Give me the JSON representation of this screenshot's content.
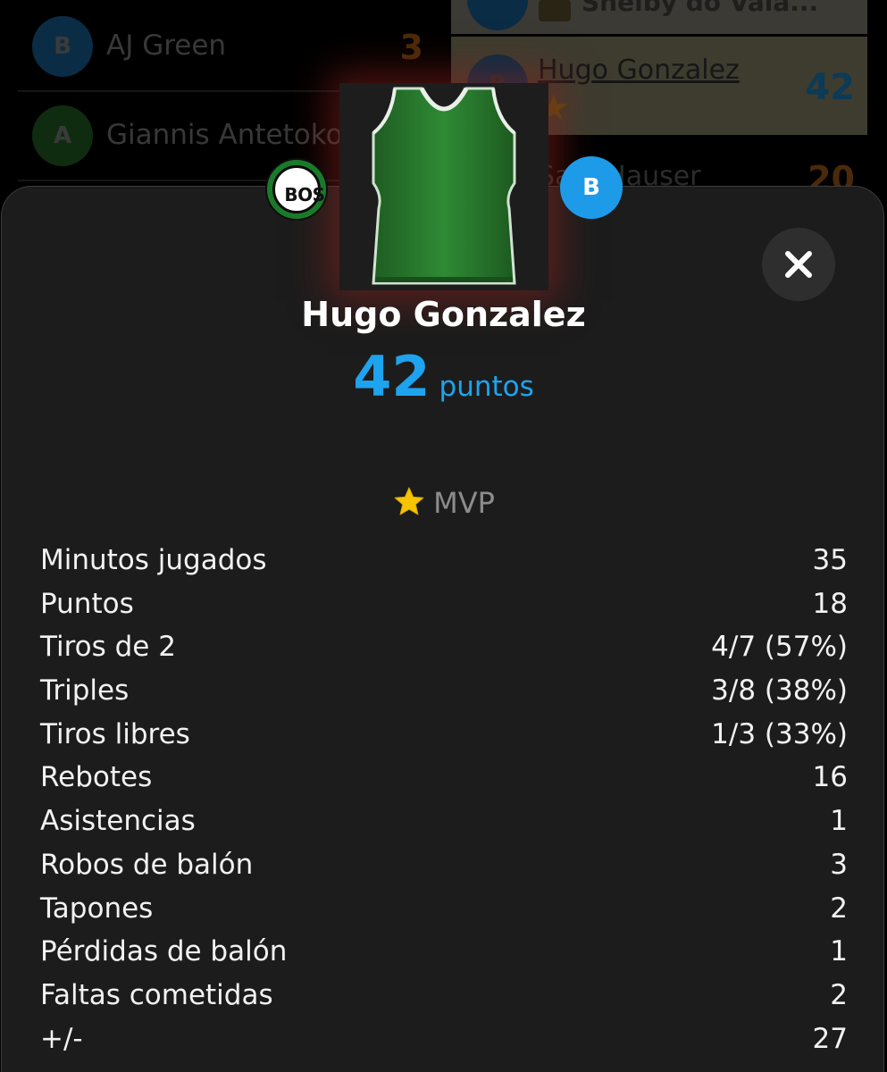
{
  "background_list": {
    "left_rows": [
      {
        "avatar_letter": "B",
        "name": "AJ Green",
        "score": "3"
      },
      {
        "avatar_letter": "A",
        "name": "Giannis Antetoko..."
      }
    ],
    "right_top_name": "Shelby do Vala...",
    "right_card": {
      "avatar_letter": "B",
      "name": "Hugo Gonzalez",
      "score": "42"
    },
    "right_third": {
      "name": "Sam Hauser",
      "score": "20"
    }
  },
  "modal": {
    "team_abbr": "BOS",
    "position_letter": "B",
    "player_name": "Hugo Gonzalez",
    "score_value": "42",
    "score_unit": "puntos",
    "mvp_label": "MVP",
    "stats": [
      {
        "label": "Minutos jugados",
        "value": "35"
      },
      {
        "label": "Puntos",
        "value": "18"
      },
      {
        "label": "Tiros de 2",
        "value": "4/7 (57%)"
      },
      {
        "label": "Triples",
        "value": "3/8 (38%)"
      },
      {
        "label": "Tiros libres",
        "value": "1/3 (33%)"
      },
      {
        "label": "Rebotes",
        "value": "16"
      },
      {
        "label": "Asistencias",
        "value": "1"
      },
      {
        "label": "Robos de balón",
        "value": "3"
      },
      {
        "label": "Tapones",
        "value": "2"
      },
      {
        "label": "Pérdidas de balón",
        "value": "1"
      },
      {
        "label": "Faltas cometidas",
        "value": "2"
      },
      {
        "label": "+/-",
        "value": "27"
      }
    ]
  },
  "icons": {
    "close": "close-icon",
    "mvp_star": "star-icon",
    "jersey": "jersey-image"
  },
  "colors": {
    "accent_blue": "#1ea3ee",
    "team_green": "#1a7a2a",
    "mvp_star": "#f6c400",
    "sheet_bg": "#1c1c1c"
  }
}
